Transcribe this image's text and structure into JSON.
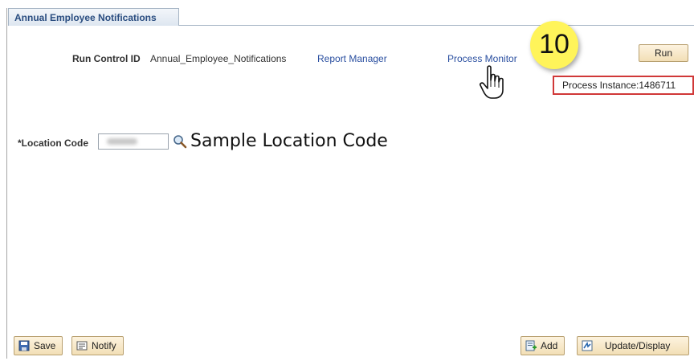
{
  "tab": {
    "label": "Annual Employee Notifications"
  },
  "run_control": {
    "label": "Run Control ID",
    "value": "Annual_Employee_Notifications",
    "report_manager": "Report Manager",
    "process_monitor": "Process Monitor"
  },
  "callout": {
    "step": "10"
  },
  "run_button": {
    "label": "Run"
  },
  "process_instance": {
    "text": "Process Instance:1486711"
  },
  "location": {
    "label": "*Location Code",
    "value": "",
    "annotation": "Sample Location Code"
  },
  "footer": {
    "save": "Save",
    "notify": "Notify",
    "add": "Add",
    "update_display": "Update/Display"
  },
  "icons": {
    "cursor": "hand-pointer-icon",
    "lookup": "magnifier-icon",
    "save": "floppy-disk-icon",
    "notify": "notify-icon",
    "add": "add-page-icon",
    "update": "update-display-icon"
  },
  "colors": {
    "callout": "#fff45a",
    "highlight_box": "#d03838",
    "link": "#2a4fa0",
    "tab_text": "#2a4d80"
  }
}
